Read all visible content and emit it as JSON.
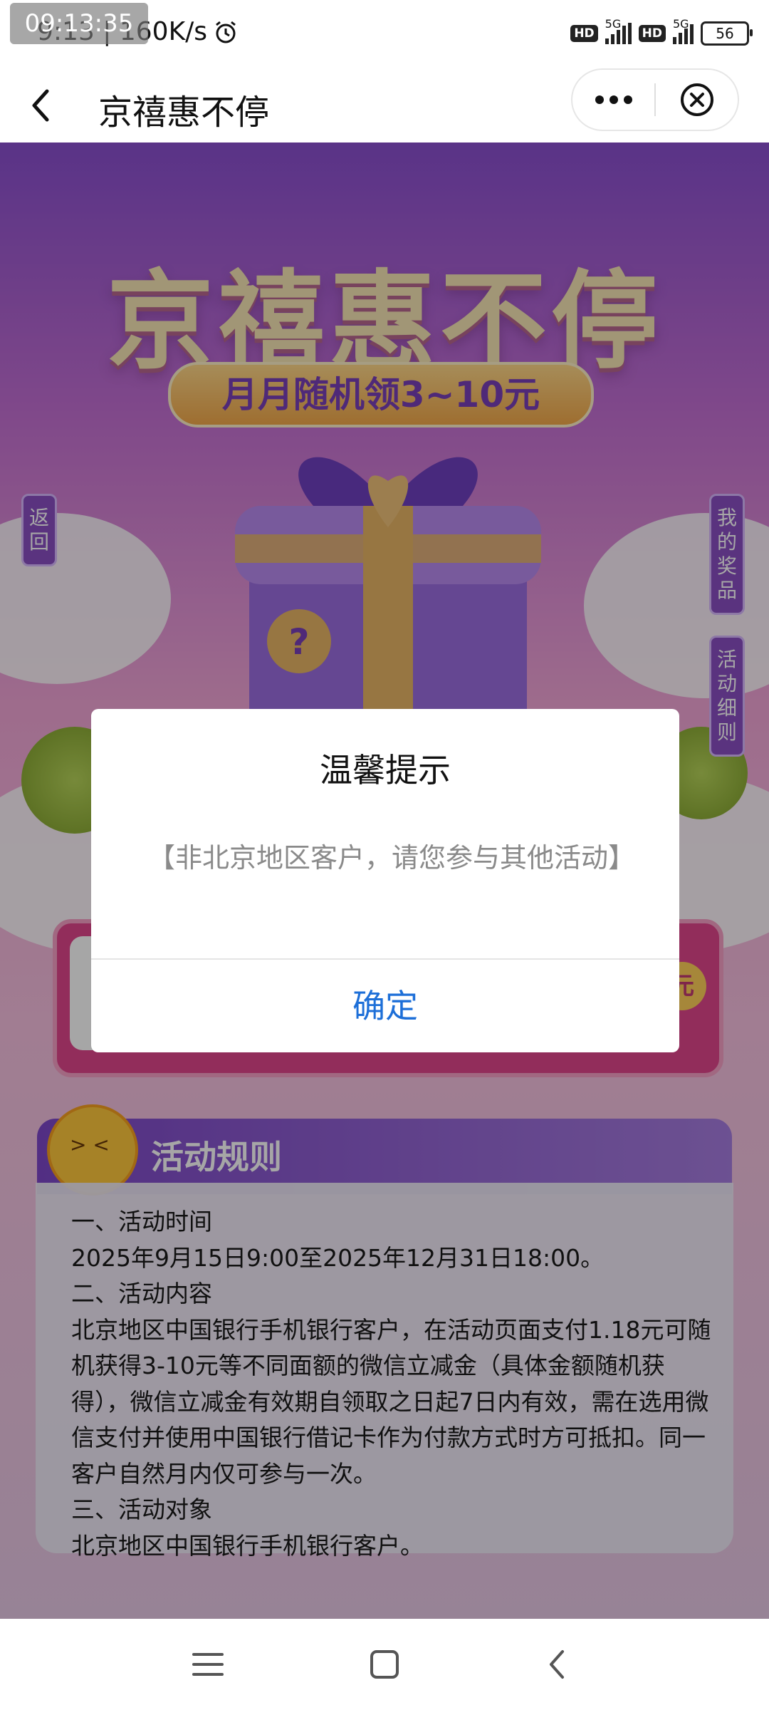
{
  "status_bar": {
    "overlay_time": "09:13:35",
    "time_speed": "9:13 | 160K/s",
    "sim1_hd": "HD",
    "sim1_net": "5G",
    "sim2_hd": "HD",
    "sim2_net": "5G",
    "battery": "56",
    "icons": [
      "alarm-icon",
      "signal-icon",
      "battery-icon"
    ]
  },
  "nav": {
    "title": "京禧惠不停",
    "back_icon": "chevron-left-icon",
    "more_icon": "more-dots-icon",
    "close_icon": "close-circle-icon"
  },
  "hero": {
    "title": "京禧惠不停",
    "subtitle": "月月随机领3~10元"
  },
  "side_tabs": {
    "back": "返回",
    "my_prizes": "我的奖品",
    "rules": "活动细则"
  },
  "prize_card": {
    "coin_char": "元"
  },
  "rules": {
    "title": "活动规则",
    "lines": [
      "一、活动时间",
      "2025年9月15日9:00至2025年12月31日18:00。",
      "二、活动内容",
      "北京地区中国银行手机银行客户，在活动页面支付1.18元可随机获得3-10元等不同面额的微信立减金（具体金额随机获得），微信立减金有效期自领取之日起7日内有效，需在选用微信支付并使用中国银行借记卡作为付款方式时方可抵扣。同一客户自然月内仅可参与一次。",
      "三、活动对象",
      "北京地区中国银行手机银行客户。"
    ]
  },
  "dialog": {
    "title": "温馨提示",
    "message": "【非北京地区客户，请您参与其他活动】",
    "ok_label": "确定"
  },
  "colors": {
    "accent_blue": "#1d6fd8",
    "purple": "#8a4fc4",
    "pink": "#e1468d",
    "gold": "#f7e7b5"
  }
}
